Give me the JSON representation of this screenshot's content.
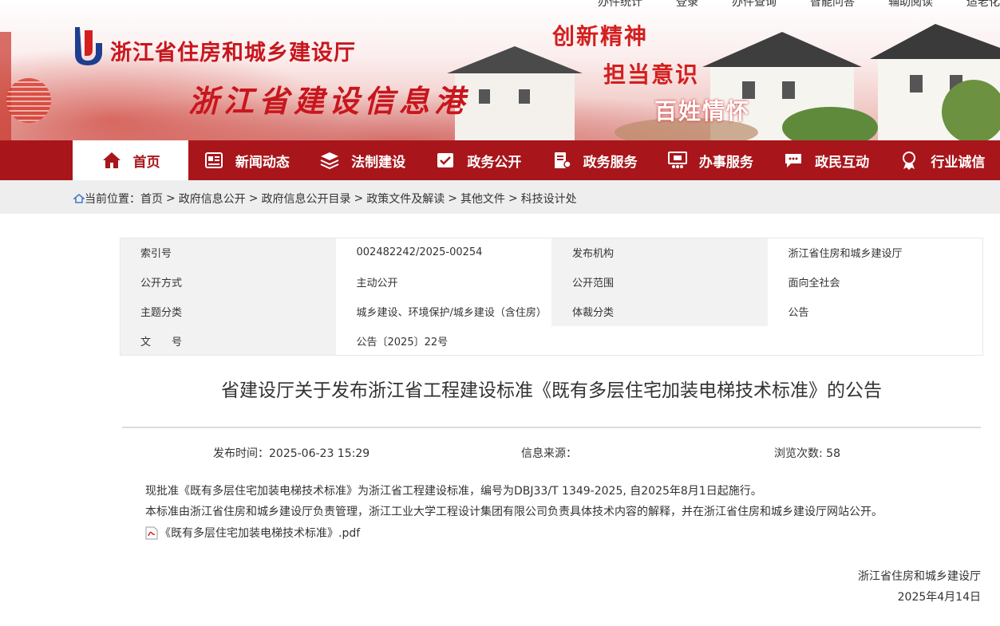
{
  "header": {
    "site_name": "浙江省住房和城乡建设厅",
    "site_sub": "浙江省建设信息港",
    "slogans": [
      "创新精神",
      "担当意识",
      "百姓情怀"
    ],
    "top_links": [
      "办件统计",
      "登录",
      "办件查询",
      "智能问答",
      "辅助阅读",
      "适老化"
    ]
  },
  "nav": {
    "items": [
      {
        "label": "首页",
        "icon": "home-icon"
      },
      {
        "label": "新闻动态",
        "icon": "newspaper-icon"
      },
      {
        "label": "法制建设",
        "icon": "layers-icon"
      },
      {
        "label": "政务公开",
        "icon": "checkbox-doc-icon"
      },
      {
        "label": "政务服务",
        "icon": "service-icon"
      },
      {
        "label": "办事服务",
        "icon": "monitor-people-icon"
      },
      {
        "label": "政民互动",
        "icon": "chat-icon"
      },
      {
        "label": "行业诚信",
        "icon": "award-icon"
      }
    ]
  },
  "breadcrumb": {
    "prefix": "当前位置：",
    "items": [
      "首页",
      "政府信息公开",
      "政府信息公开目录",
      "政策文件及解读",
      "其他文件",
      "科技设计处"
    ],
    "separator": ">"
  },
  "info": {
    "rows": [
      [
        "索引号",
        "002482242/2025-00254",
        "发布机构",
        "浙江省住房和城乡建设厅"
      ],
      [
        "公开方式",
        "主动公开",
        "公开范围",
        "面向全社会"
      ],
      [
        "主题分类",
        "城乡建设、环境保护/城乡建设（含住房）",
        "体裁分类",
        "公告"
      ],
      [
        "文　　号",
        "公告〔2025〕22号"
      ]
    ]
  },
  "article": {
    "title": "省建设厅关于发布浙江省工程建设标准《既有多层住宅加装电梯技术标准》的公告",
    "publish_time": "发布时间：2025-06-23 15:29",
    "source": "信息来源：",
    "views": "浏览次数: 58",
    "paragraph1": "现批准《既有多层住宅加装电梯技术标准》为浙江省工程建设标准，编号为DBJ33/T 1349-2025, 自2025年8月1日起施行。",
    "paragraph2": "本标准由浙江省住房和城乡建设厅负责管理，浙江工业大学工程设计集团有限公司负责具体技术内容的解释，并在浙江省住房和城乡建设厅网站公开。",
    "attachment": "《既有多层住宅加装电梯技术标准》.pdf",
    "sign_org": "浙江省住房和城乡建设厅",
    "sign_date": "2025年4月14日"
  },
  "colors": {
    "brand_red": "#a8161b",
    "title_red": "#c8161d"
  }
}
